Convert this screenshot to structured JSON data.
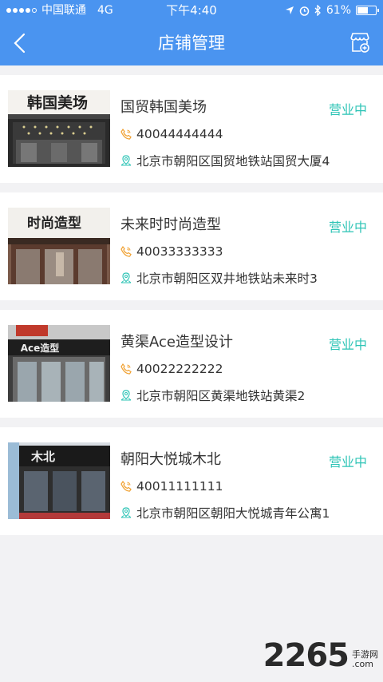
{
  "status_bar": {
    "carrier": "中国联通",
    "network": "4G",
    "time": "下午4:40",
    "battery": "61%",
    "battery_level": 0.61
  },
  "header": {
    "title": "店铺管理",
    "back_icon": "chevron-left-icon",
    "action_icon": "store-add-icon"
  },
  "colors": {
    "header_bg": "#4a94f0",
    "status_open": "#2ec4b6",
    "icon_orange": "#f0a030",
    "icon_teal": "#2ec4b6"
  },
  "stores": [
    {
      "name": "国贸韩国美场",
      "status": "营业中",
      "phone": "40044444444",
      "address": "北京市朝阳区国贸地铁站国贸大厦4",
      "thumb_sign": "韩国美场"
    },
    {
      "name": "未来时时尚造型",
      "status": "营业中",
      "phone": "40033333333",
      "address": "北京市朝阳区双井地铁站未来时3",
      "thumb_sign": "时尚造型"
    },
    {
      "name": "黄渠Ace造型设计",
      "status": "营业中",
      "phone": "40022222222",
      "address": "北京市朝阳区黄渠地铁站黄渠2",
      "thumb_sign": "Ace造型"
    },
    {
      "name": "朝阳大悦城木北",
      "status": "营业中",
      "phone": "40011111111",
      "address": "北京市朝阳区朝阳大悦城青年公寓1",
      "thumb_sign": "木北"
    }
  ],
  "watermark": {
    "number": "2265",
    "site": "手游网",
    "domain": ".com"
  }
}
